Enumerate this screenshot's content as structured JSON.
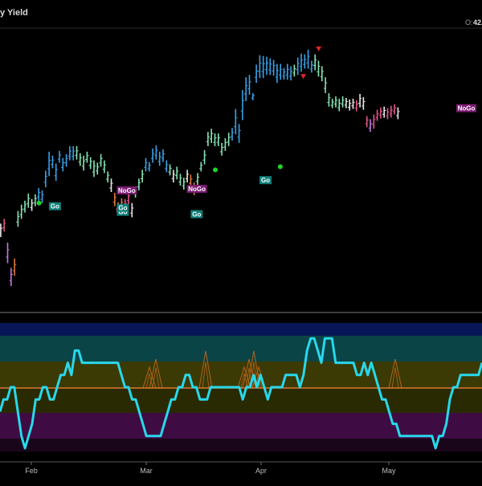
{
  "header": {
    "title": "y Yield",
    "open_label": "O:",
    "open_value": "42."
  },
  "colors": {
    "background": "#000000",
    "strong_up": "#3aa0e6",
    "weak_up": "#86e3b3",
    "weak_down": "#e0568c",
    "strong_down": "#c079df",
    "nogo": "#e07a3a",
    "neutral": "#e8e8e8",
    "oscillator": "#28d8ec",
    "zero_line": "#e07b2e",
    "volume": "#b4651c"
  },
  "chart_data": [
    {
      "type": "candlestick",
      "title": "y Yield",
      "x_tick_labels": [
        "Feb",
        "Mar",
        "Apr",
        "May"
      ],
      "series": [
        {
          "name": "price bars",
          "bars": [
            [
              "neutral",
              19.5,
              18.4
            ],
            [
              "neutral",
              17.4,
              15.4
            ],
            [
              "neutral",
              16.4,
              14.4
            ],
            [
              "neutral",
              16.8,
              15.1
            ],
            [
              "weak_down",
              17.4,
              15.8
            ],
            [
              "strong_down",
              14.4,
              11.8
            ],
            [
              "strong_down",
              11.2,
              8.9
            ],
            [
              "nogo",
              12.4,
              10.2
            ],
            [
              "weak_up",
              18.4,
              16.4
            ],
            [
              "weak_up",
              19.2,
              17.4
            ],
            [
              "weak_up",
              19.7,
              18.2
            ],
            [
              "weak_up",
              20.6,
              18.8
            ],
            [
              "neutral",
              19.9,
              18.4
            ],
            [
              "weak_up",
              20.5,
              19.0
            ],
            [
              "strong_up",
              21.3,
              19.7
            ],
            [
              "strong_up",
              21.0,
              19.4
            ],
            [
              "strong_up",
              23.5,
              21.4
            ],
            [
              "strong_up",
              25.9,
              22.8
            ],
            [
              "strong_up",
              25.4,
              23.8
            ],
            [
              "strong_up",
              24.4,
              22.2
            ],
            [
              "strong_up",
              26.0,
              24.5
            ],
            [
              "strong_up",
              25.1,
              23.4
            ],
            [
              "strong_up",
              25.6,
              24.0
            ],
            [
              "strong_up",
              26.6,
              24.8
            ],
            [
              "strong_up",
              26.6,
              24.8
            ],
            [
              "weak_up",
              26.6,
              24.9
            ],
            [
              "weak_up",
              25.7,
              24.1
            ],
            [
              "weak_up",
              25.4,
              23.5
            ],
            [
              "weak_up",
              25.9,
              24.5
            ],
            [
              "weak_up",
              25.2,
              23.7
            ],
            [
              "weak_up",
              24.8,
              22.7
            ],
            [
              "weak_up",
              24.5,
              23.0
            ],
            [
              "weak_up",
              25.6,
              24.0
            ],
            [
              "weak_up",
              24.8,
              23.2
            ],
            [
              "weak_up",
              23.4,
              22.0
            ],
            [
              "neutral",
              22.5,
              20.8
            ],
            [
              "nogo",
              20.7,
              19.0
            ],
            [
              "nogo",
              19.5,
              17.8
            ],
            [
              "nogo",
              20.0,
              18.6
            ],
            [
              "weak_down",
              19.9,
              18.4
            ],
            [
              "weak_down",
              20.9,
              19.2
            ],
            [
              "neutral",
              19.4,
              17.6
            ],
            [
              "weak_up",
              21.5,
              20.1
            ],
            [
              "weak_up",
              22.5,
              21.0
            ],
            [
              "weak_up",
              23.6,
              22.0
            ],
            [
              "strong_up",
              25.1,
              23.4
            ],
            [
              "strong_up",
              24.6,
              23.4
            ],
            [
              "strong_up",
              26.3,
              24.5
            ],
            [
              "strong_up",
              26.7,
              24.9
            ],
            [
              "strong_up",
              25.9,
              24.1
            ],
            [
              "strong_up",
              26.2,
              24.6
            ],
            [
              "strong_up",
              24.8,
              23.3
            ],
            [
              "weak_up",
              24.3,
              22.9
            ],
            [
              "neutral",
              23.6,
              22.0
            ],
            [
              "weak_up",
              24.0,
              22.4
            ],
            [
              "weak_up",
              23.1,
              21.6
            ],
            [
              "weak_up",
              22.6,
              21.1
            ],
            [
              "neutral",
              23.6,
              22.0
            ],
            [
              "nogo",
              23.0,
              21.4
            ],
            [
              "nogo",
              22.0,
              20.4
            ],
            [
              "weak_up",
              23.2,
              21.7
            ],
            [
              "weak_up",
              24.6,
              23.4
            ],
            [
              "weak_up",
              26.1,
              24.3
            ],
            [
              "weak_up",
              28.4,
              26.6
            ],
            [
              "weak_up",
              28.8,
              27.0
            ],
            [
              "weak_up",
              28.2,
              26.6
            ],
            [
              "weak_up",
              28.2,
              26.6
            ],
            [
              "weak_up",
              27.0,
              25.4
            ],
            [
              "weak_up",
              27.6,
              26.0
            ],
            [
              "weak_up",
              28.3,
              26.6
            ],
            [
              "strong_up",
              28.9,
              27.3
            ],
            [
              "strong_up",
              31.3,
              28.1
            ],
            [
              "strong_up",
              29.4,
              27.0
            ],
            [
              "strong_up",
              33.7,
              29.9
            ],
            [
              "strong_up",
              35.3,
              32.3
            ],
            [
              "strong_up",
              35.6,
              33.1
            ],
            [
              "strong_up",
              33.3,
              32.4
            ],
            [
              "strong_up",
              36.9,
              34.6
            ],
            [
              "strong_up",
              38.1,
              35.2
            ],
            [
              "strong_up",
              38.0,
              35.2
            ],
            [
              "strong_up",
              37.9,
              35.6
            ],
            [
              "strong_up",
              37.7,
              35.6
            ],
            [
              "strong_up",
              37.5,
              35.5
            ],
            [
              "strong_up",
              37.0,
              34.6
            ],
            [
              "strong_up",
              37.0,
              35.0
            ],
            [
              "strong_up",
              36.5,
              35.0
            ],
            [
              "strong_up",
              37.0,
              35.0
            ],
            [
              "strong_up",
              36.7,
              34.9
            ],
            [
              "weak_up",
              36.9,
              35.4
            ],
            [
              "strong_up",
              37.8,
              35.6
            ],
            [
              "strong_up",
              38.3,
              36.0
            ],
            [
              "strong_up",
              38.2,
              36.4
            ],
            [
              "strong_up",
              38.8,
              36.4
            ],
            [
              "strong_up",
              37.4,
              35.9
            ],
            [
              "weak_up",
              38.2,
              36.2
            ],
            [
              "weak_up",
              37.4,
              35.4
            ],
            [
              "weak_up",
              36.7,
              34.8
            ],
            [
              "weak_up",
              35.3,
              33.3
            ],
            [
              "weak_up",
              33.3,
              31.6
            ],
            [
              "weak_up",
              32.6,
              31.4
            ],
            [
              "weak_up",
              32.9,
              31.5
            ],
            [
              "weak_up",
              32.6,
              31.0
            ],
            [
              "weak_up",
              32.9,
              31.5
            ],
            [
              "neutral",
              32.7,
              31.4
            ],
            [
              "neutral",
              32.5,
              31.1
            ],
            [
              "neutral",
              32.6,
              31.3
            ],
            [
              "weak_down",
              32.4,
              31.0
            ],
            [
              "neutral",
              33.2,
              31.5
            ],
            [
              "neutral",
              32.8,
              31.2
            ],
            [
              "weak_down",
              30.4,
              29.0
            ],
            [
              "strong_down",
              30.0,
              28.4
            ],
            [
              "weak_down",
              30.6,
              28.8
            ],
            [
              "weak_down",
              31.2,
              29.8
            ],
            [
              "weak_down",
              31.5,
              30.1
            ],
            [
              "neutral",
              31.6,
              30.2
            ],
            [
              "weak_down",
              31.4,
              30.0
            ],
            [
              "weak_down",
              31.7,
              30.2
            ],
            [
              "weak_down",
              31.9,
              30.6
            ],
            [
              "neutral",
              31.5,
              30.0
            ]
          ]
        },
        {
          "name": "oscillator",
          "values": [
            -2,
            -1,
            -1,
            0,
            0,
            -2,
            -4,
            -5,
            -4,
            -3,
            -1,
            -1,
            0,
            0,
            -1,
            -1,
            0,
            1,
            1,
            2,
            1,
            3,
            3,
            2,
            2,
            2,
            2,
            2,
            2,
            2,
            2,
            2,
            2,
            2,
            1,
            0,
            0,
            -1,
            -1,
            -2,
            -3,
            -4,
            -4,
            -4,
            -4,
            -4,
            -3,
            -2,
            -1,
            -1,
            0,
            0,
            1,
            1,
            0,
            0,
            -1,
            -1,
            -1,
            0,
            0,
            0,
            0,
            0,
            0,
            0,
            0,
            0,
            -1,
            0,
            0,
            1,
            0,
            1,
            0,
            -1,
            0,
            0,
            0,
            0,
            1,
            1,
            1,
            1,
            0,
            1,
            3,
            4,
            4,
            3,
            2,
            4,
            4,
            4,
            2,
            2,
            2,
            2,
            2,
            2,
            1,
            1,
            2,
            1,
            2,
            1,
            0,
            -1,
            -1,
            -2,
            -3,
            -3,
            -4,
            -4,
            -4,
            -4,
            -4,
            -4,
            -4,
            -4,
            -4,
            -4,
            -5,
            -4,
            -4,
            -3,
            -1,
            0,
            0,
            1,
            1,
            1,
            1,
            1,
            1,
            2
          ],
          "ylim": [
            -5,
            5
          ],
          "zones": [
            {
              "name": "strong_up",
              "range": [
                4,
                5
              ],
              "color": "#061656"
            },
            {
              "name": "weak_up",
              "range": [
                2,
                4
              ],
              "color": "#0a4447"
            },
            {
              "name": "weak_down_upper",
              "range": [
                0,
                2
              ],
              "color": "#3b3a04"
            },
            {
              "name": "weak_down_lower",
              "range": [
                -2,
                0
              ],
              "color": "#2a2a02"
            },
            {
              "name": "strong_down",
              "range": [
                -4,
                -2
              ],
              "color": "#3e0c42"
            },
            {
              "name": "deep_down",
              "range": [
                -5,
                -4
              ],
              "color": "#1a061a"
            }
          ]
        },
        {
          "name": "volume spikes",
          "values": [
            0,
            0,
            0,
            0,
            0,
            0,
            0,
            0,
            0,
            0,
            0,
            0,
            0,
            0,
            0,
            0,
            0,
            0,
            0,
            0,
            0,
            0,
            0,
            0,
            0,
            0,
            0,
            0,
            0,
            0,
            0,
            0,
            0,
            0,
            0,
            0,
            0,
            0,
            0,
            0,
            0,
            0,
            0,
            0,
            0,
            0,
            0,
            0,
            0,
            0,
            0,
            0,
            0,
            0,
            0,
            0,
            0,
            0,
            0,
            0,
            0,
            0,
            0,
            0,
            0,
            0,
            0,
            0,
            0,
            0,
            0,
            0,
            0,
            0,
            0,
            0,
            0,
            0,
            0,
            0,
            0,
            0,
            0,
            0,
            0,
            0,
            0,
            0,
            0,
            0,
            0,
            0,
            0,
            0,
            0,
            0,
            0,
            0,
            0,
            0,
            0,
            0,
            0,
            0,
            0,
            0,
            0,
            0,
            0,
            0,
            0,
            0,
            0,
            0,
            0,
            0,
            0,
            0,
            0,
            0,
            0,
            0,
            0,
            0,
            0,
            0,
            0,
            0,
            0,
            0,
            0,
            0,
            0,
            0,
            0,
            0,
            0,
            0,
            0,
            0,
            0
          ]
        }
      ],
      "annotations": [
        {
          "text": "NoGo",
          "kind": "nogo",
          "x_date": "Jan 31",
          "y": 21.0
        },
        {
          "text": "Go",
          "kind": "go",
          "x_date": "Jan 31",
          "y": 18.3
        },
        {
          "text": "Go",
          "kind": "go",
          "x_date": "Jan 31",
          "y": 18.8
        },
        {
          "text": "Go",
          "kind": "go",
          "x_date": "Feb 6",
          "y": 19.0
        },
        {
          "text": "NoGo",
          "kind": "nogo",
          "x_date": "Mar 12",
          "y": 21.2
        },
        {
          "text": "Go",
          "kind": "go",
          "x_date": "Mar 13",
          "y": 18.0
        },
        {
          "text": "Go",
          "kind": "go",
          "x_date": "Apr 1",
          "y": 22.3
        },
        {
          "text": "NoGo",
          "kind": "nogo",
          "x_date": "May 19",
          "y": 31.4
        }
      ],
      "markers": [
        {
          "kind": "green-dot",
          "x_date": "Feb 3",
          "y": 19.4
        },
        {
          "kind": "green-dot",
          "x_date": "Mar 19",
          "y": 23.6
        },
        {
          "kind": "green-dot",
          "x_date": "Apr 6",
          "y": 24.0
        },
        {
          "kind": "red-dot",
          "x_date": "Jan 31",
          "y": 18.6
        },
        {
          "kind": "red-triangle",
          "x_date": "Apr 16",
          "y": 38.9
        },
        {
          "kind": "red-triangle",
          "x_date": "Apr 12",
          "y": 35.4
        }
      ]
    }
  ]
}
